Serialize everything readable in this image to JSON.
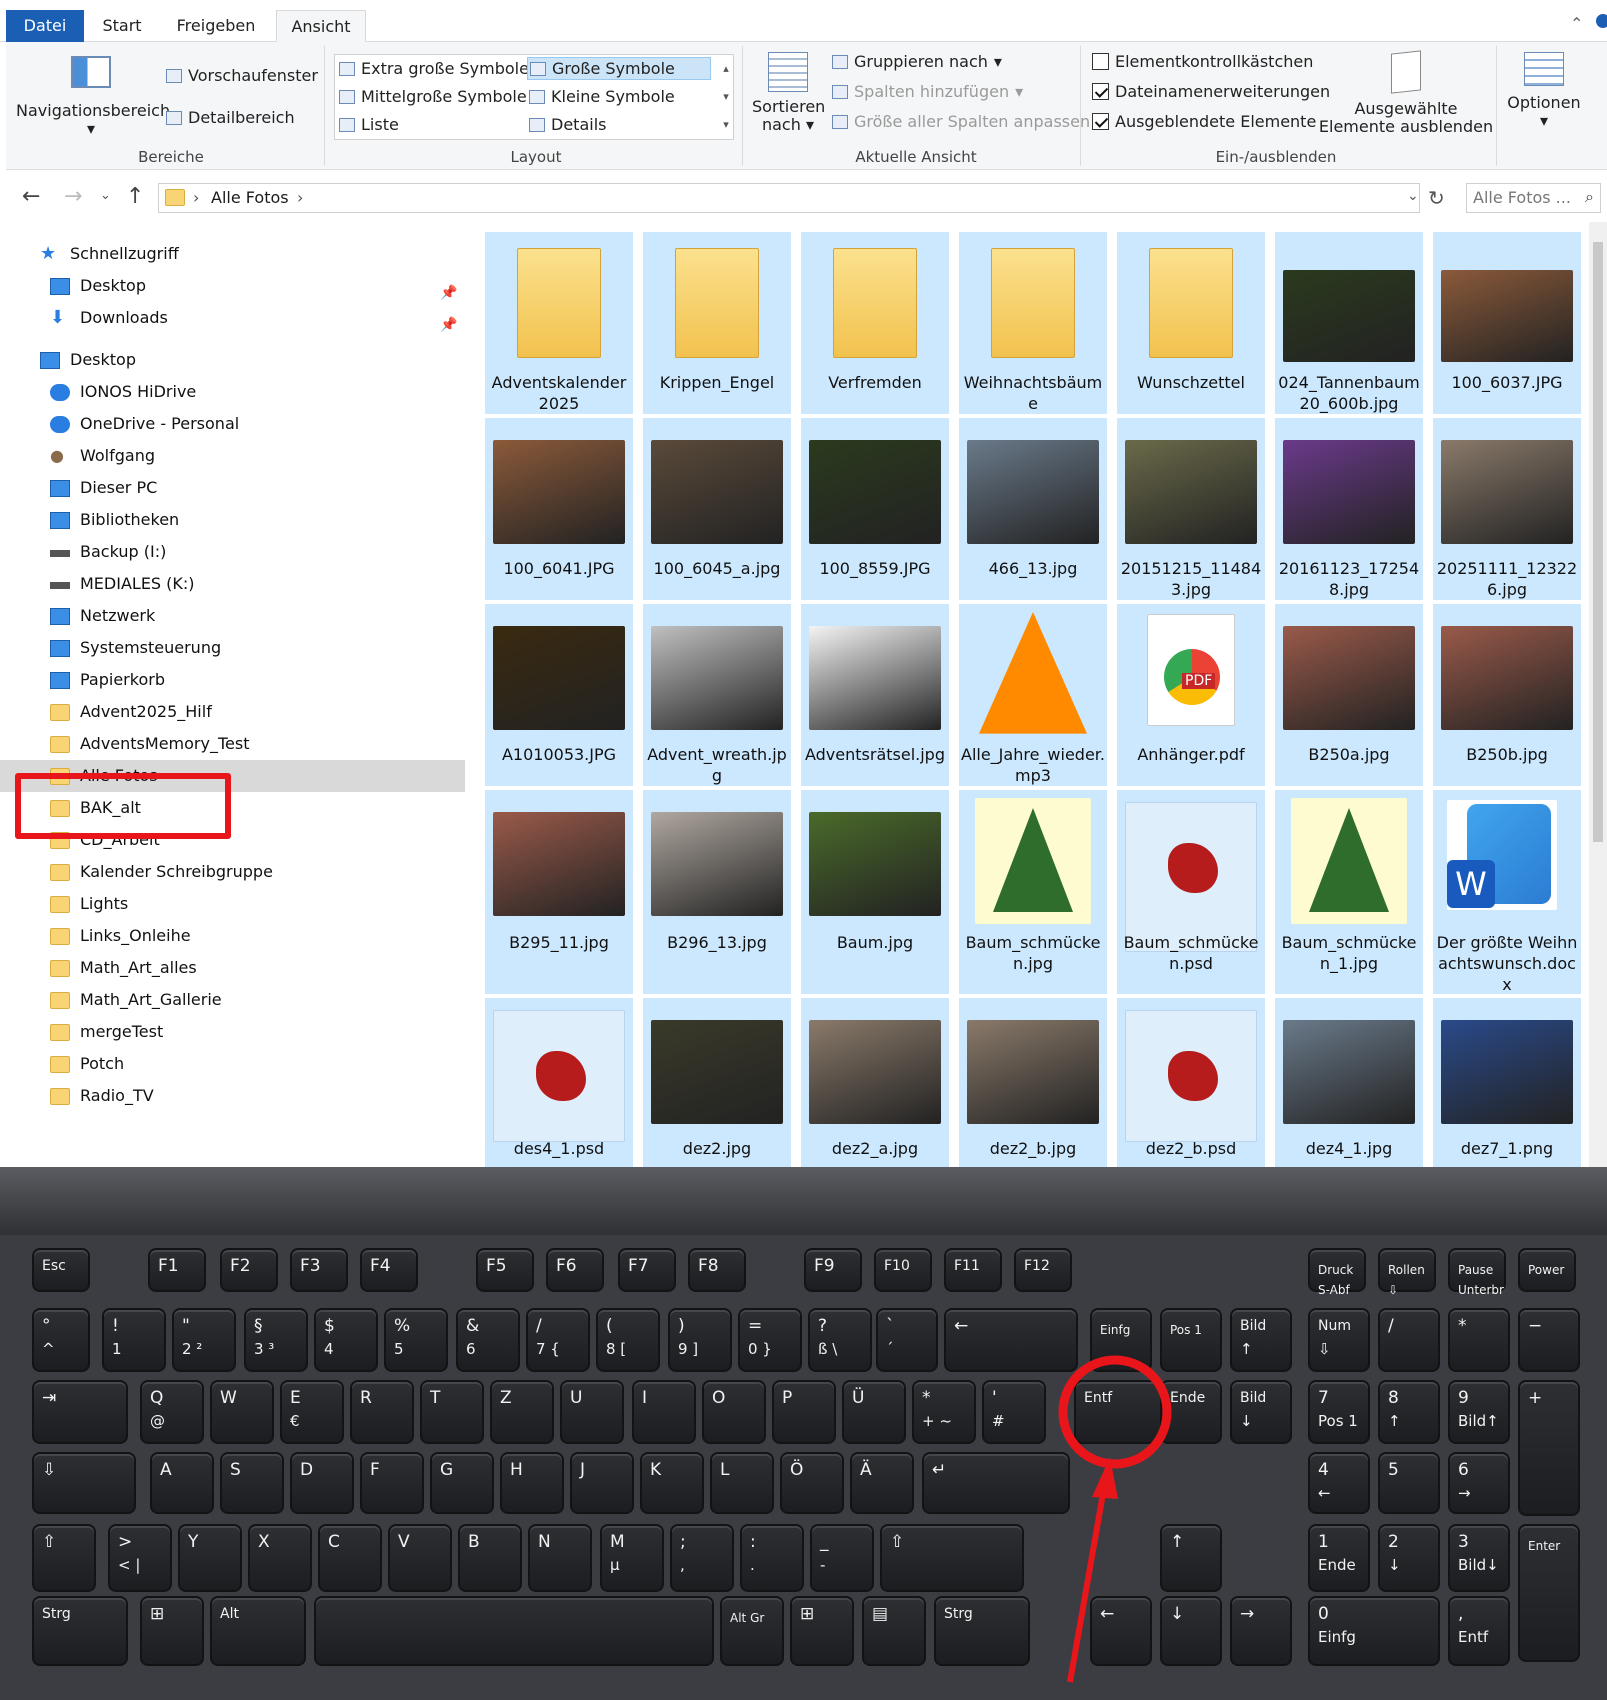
{
  "tabs": {
    "file": "Datei",
    "start": "Start",
    "share": "Freigeben",
    "view": "Ansicht"
  },
  "ribbon": {
    "panes": {
      "nav_pane": "Navigationsbereich",
      "preview": "Vorschaufenster",
      "details": "Detailbereich",
      "group": "Bereiche"
    },
    "layout": {
      "extra_large": "Extra große Symbole",
      "large": "Große Symbole",
      "medium": "Mittelgroße Symbole",
      "small": "Kleine Symbole",
      "list": "Liste",
      "details": "Details",
      "group": "Layout"
    },
    "current_view": {
      "sort": "Sortieren",
      "sort2": "nach",
      "group_by": "Gruppieren nach",
      "add_columns": "Spalten hinzufügen",
      "fit_columns": "Größe aller Spalten anpassen",
      "group": "Aktuelle Ansicht"
    },
    "show_hide": {
      "item_checkboxes": "Elementkontrollkästchen",
      "file_ext": "Dateinamenerweiterungen",
      "hidden_items": "Ausgeblendete Elemente",
      "hide_selected_1": "Ausgewählte",
      "hide_selected_2": "Elemente ausblenden",
      "group": "Ein-/ausblenden",
      "item_checkboxes_checked": false,
      "file_ext_checked": true,
      "hidden_items_checked": true
    },
    "options": "Optionen"
  },
  "address": {
    "current": "Alle Fotos",
    "search_placeholder": "Alle Fotos ..."
  },
  "nav": [
    {
      "label": "Schnellzugriff",
      "icon": "star-icon",
      "indent": 1
    },
    {
      "label": "Desktop",
      "icon": "desktop-icon",
      "indent": 2,
      "pinned": true
    },
    {
      "label": "Downloads",
      "icon": "download-icon",
      "indent": 2,
      "pinned": true
    },
    {
      "label": "Desktop",
      "icon": "desktop-icon",
      "indent": 1
    },
    {
      "label": "IONOS HiDrive",
      "icon": "cloud-icon",
      "indent": 2
    },
    {
      "label": "OneDrive - Personal",
      "icon": "onedrive-icon",
      "indent": 2
    },
    {
      "label": "Wolfgang",
      "icon": "user-icon",
      "indent": 2
    },
    {
      "label": "Dieser PC",
      "icon": "pc-icon",
      "indent": 2
    },
    {
      "label": "Bibliotheken",
      "icon": "library-icon",
      "indent": 2
    },
    {
      "label": "Backup (I:)",
      "icon": "drive-icon",
      "indent": 2
    },
    {
      "label": "MEDIALES (K:)",
      "icon": "drive-icon",
      "indent": 2
    },
    {
      "label": "Netzwerk",
      "icon": "network-icon",
      "indent": 2
    },
    {
      "label": "Systemsteuerung",
      "icon": "control-panel-icon",
      "indent": 2
    },
    {
      "label": "Papierkorb",
      "icon": "recycle-bin-icon",
      "indent": 2
    },
    {
      "label": "Advent2025_Hilf",
      "icon": "folder-icon",
      "indent": 2
    },
    {
      "label": "AdventsMemory_Test",
      "icon": "folder-icon",
      "indent": 2
    },
    {
      "label": "Alle Fotos",
      "icon": "folder-icon",
      "indent": 2,
      "selected": true
    },
    {
      "label": "BAK_alt",
      "icon": "folder-icon",
      "indent": 2
    },
    {
      "label": "CD_Arbeit",
      "icon": "folder-icon",
      "indent": 2
    },
    {
      "label": "Kalender Schreibgruppe",
      "icon": "folder-icon",
      "indent": 2
    },
    {
      "label": "Lights",
      "icon": "folder-icon",
      "indent": 2
    },
    {
      "label": "Links_Onleihe",
      "icon": "folder-icon",
      "indent": 2
    },
    {
      "label": "Math_Art_alles",
      "icon": "folder-icon",
      "indent": 2
    },
    {
      "label": "Math_Art_Gallerie",
      "icon": "folder-icon",
      "indent": 2
    },
    {
      "label": "mergeTest",
      "icon": "folder-icon",
      "indent": 2
    },
    {
      "label": "Potch",
      "icon": "folder-icon",
      "indent": 2
    },
    {
      "label": "Radio_TV",
      "icon": "folder-icon",
      "indent": 2
    }
  ],
  "files": [
    {
      "name": "Adventskalender 2025",
      "kind": "folder-icon"
    },
    {
      "name": "Krippen_Engel",
      "kind": "folder-icon"
    },
    {
      "name": "Verfremden",
      "kind": "folder-icon"
    },
    {
      "name": "Weihnachtsbäume",
      "kind": "folder-icon"
    },
    {
      "name": "Wunschzettel",
      "kind": "folder-icon"
    },
    {
      "name": "024_Tannenbaum20_600b.jpg",
      "kind": "photo-tree"
    },
    {
      "name": "100_6037.JPG",
      "kind": "photo-house"
    },
    {
      "name": "100_6041.JPG",
      "kind": "photo-house"
    },
    {
      "name": "100_6045_a.jpg",
      "kind": "photo-tower"
    },
    {
      "name": "100_8559.JPG",
      "kind": "photo-tree"
    },
    {
      "name": "466_13.jpg",
      "kind": "photo-child"
    },
    {
      "name": "20151215_114843.jpg",
      "kind": "photo-market"
    },
    {
      "name": "20161123_172548.jpg",
      "kind": "photo-shop"
    },
    {
      "name": "20251111_123226.jpg",
      "kind": "photo-shelf"
    },
    {
      "name": "A1010053.JPG",
      "kind": "photo-night"
    },
    {
      "name": "Advent_wreath.jpg",
      "kind": "photo-wreath"
    },
    {
      "name": "Adventsrätsel.jpg",
      "kind": "photo-document"
    },
    {
      "name": "Alle_Jahre_wieder.mp3",
      "kind": "vlc-icon"
    },
    {
      "name": "Anhänger.pdf",
      "kind": "pdf-icon"
    },
    {
      "name": "B250a.jpg",
      "kind": "photo-santa"
    },
    {
      "name": "B250b.jpg",
      "kind": "photo-santa"
    },
    {
      "name": "B295_11.jpg",
      "kind": "photo-santa"
    },
    {
      "name": "B296_13.jpg",
      "kind": "photo-room"
    },
    {
      "name": "Baum.jpg",
      "kind": "photo-forest"
    },
    {
      "name": "Baum_schmücken.jpg",
      "kind": "clipart-tree"
    },
    {
      "name": "Baum_schmücken.psd",
      "kind": "psd-icon"
    },
    {
      "name": "Baum_schmücken_1.jpg",
      "kind": "clipart-tree"
    },
    {
      "name": "Der größte Weihnachtswunsch.docx",
      "kind": "word-icon"
    },
    {
      "name": "des4_1.psd",
      "kind": "psd-icon"
    },
    {
      "name": "dez2.jpg",
      "kind": "photo-candle"
    },
    {
      "name": "dez2_a.jpg",
      "kind": "photo-shelf"
    },
    {
      "name": "dez2_b.jpg",
      "kind": "photo-shelf"
    },
    {
      "name": "dez2_b.psd",
      "kind": "psd-icon"
    },
    {
      "name": "dez4_1.jpg",
      "kind": "photo-child"
    },
    {
      "name": "dez7_1.png",
      "kind": "photo-box"
    }
  ],
  "keyboard": {
    "rows": [
      [
        {
          "l": "Esc"
        },
        {
          "l": "F1"
        },
        {
          "l": "F2"
        },
        {
          "l": "F3"
        },
        {
          "l": "F4"
        },
        {
          "l": "F5"
        },
        {
          "l": "F6"
        },
        {
          "l": "F7"
        },
        {
          "l": "F8"
        },
        {
          "l": "F9"
        },
        {
          "l": "F10"
        },
        {
          "l": "F11"
        },
        {
          "l": "F12"
        },
        {
          "l": "Druck\nS-Abf"
        },
        {
          "l": "Rollen\n⇩"
        },
        {
          "l": "Pause\nUnterbr"
        },
        {
          "l": "Power"
        }
      ],
      [
        {
          "l": "°",
          "s": "^"
        },
        {
          "l": "!",
          "s": "1"
        },
        {
          "l": "\"",
          "s": "2 ²"
        },
        {
          "l": "§",
          "s": "3 ³"
        },
        {
          "l": "$",
          "s": "4"
        },
        {
          "l": "%",
          "s": "5"
        },
        {
          "l": "&",
          "s": "6"
        },
        {
          "l": "/",
          "s": "7 {"
        },
        {
          "l": "(",
          "s": "8 ["
        },
        {
          "l": ")",
          "s": "9 ]"
        },
        {
          "l": "=",
          "s": "0 }"
        },
        {
          "l": "?",
          "s": "ß \\"
        },
        {
          "l": "`",
          "s": "´"
        },
        {
          "l": "←"
        },
        {
          "l": "Einfg"
        },
        {
          "l": "Pos 1"
        },
        {
          "l": "Bild",
          "s": "↑"
        },
        {
          "l": "Num",
          "s": "⇩"
        },
        {
          "l": "/"
        },
        {
          "l": "*"
        },
        {
          "l": "−"
        }
      ],
      [
        {
          "l": "⇥"
        },
        {
          "l": "Q",
          "s": "@"
        },
        {
          "l": "W"
        },
        {
          "l": "E",
          "s": "€"
        },
        {
          "l": "R"
        },
        {
          "l": "T"
        },
        {
          "l": "Z"
        },
        {
          "l": "U"
        },
        {
          "l": "I"
        },
        {
          "l": "O"
        },
        {
          "l": "P"
        },
        {
          "l": "Ü"
        },
        {
          "l": "*",
          "s": "+ ~"
        },
        {
          "l": "'",
          "s": "#"
        },
        {
          "l": "Entf"
        },
        {
          "l": "Ende"
        },
        {
          "l": "Bild",
          "s": "↓"
        },
        {
          "l": "7",
          "s": "Pos 1"
        },
        {
          "l": "8",
          "s": "↑"
        },
        {
          "l": "9",
          "s": "Bild↑"
        },
        {
          "l": "+"
        }
      ],
      [
        {
          "l": "⇩"
        },
        {
          "l": "A"
        },
        {
          "l": "S"
        },
        {
          "l": "D"
        },
        {
          "l": "F"
        },
        {
          "l": "G"
        },
        {
          "l": "H"
        },
        {
          "l": "J"
        },
        {
          "l": "K"
        },
        {
          "l": "L"
        },
        {
          "l": "Ö"
        },
        {
          "l": "Ä"
        },
        {
          "l": "↵"
        },
        {
          "l": "4",
          "s": "←"
        },
        {
          "l": "5"
        },
        {
          "l": "6",
          "s": "→"
        }
      ],
      [
        {
          "l": "⇧"
        },
        {
          "l": ">",
          "s": "< |"
        },
        {
          "l": "Y"
        },
        {
          "l": "X"
        },
        {
          "l": "C"
        },
        {
          "l": "V"
        },
        {
          "l": "B"
        },
        {
          "l": "N"
        },
        {
          "l": "M",
          "s": "µ"
        },
        {
          "l": ";",
          "s": ","
        },
        {
          "l": ":",
          "s": "."
        },
        {
          "l": "_",
          "s": "-"
        },
        {
          "l": "⇧"
        },
        {
          "l": "↑"
        },
        {
          "l": "1",
          "s": "Ende"
        },
        {
          "l": "2",
          "s": "↓"
        },
        {
          "l": "3",
          "s": "Bild↓"
        },
        {
          "l": "Enter"
        }
      ],
      [
        {
          "l": "Strg"
        },
        {
          "l": "⊞"
        },
        {
          "l": "Alt"
        },
        {
          "l": ""
        },
        {
          "l": "Alt Gr"
        },
        {
          "l": "⊞"
        },
        {
          "l": "▤"
        },
        {
          "l": "Strg"
        },
        {
          "l": "←"
        },
        {
          "l": "↓"
        },
        {
          "l": "→"
        },
        {
          "l": "0",
          "s": "Einfg"
        },
        {
          "l": ",",
          "s": "Entf"
        }
      ]
    ]
  },
  "colors": {
    "accent": "#1a5fb4",
    "selection": "#cce8ff",
    "highlight": "#e8161b",
    "keyboard": "#3b3d42"
  }
}
